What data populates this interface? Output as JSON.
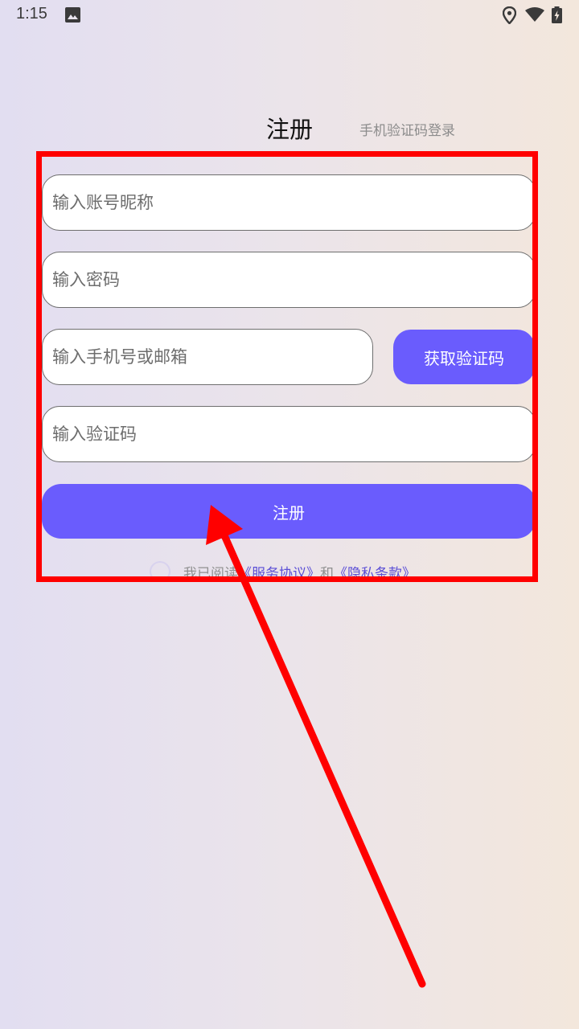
{
  "status_bar": {
    "time": "1:15"
  },
  "tabs": {
    "register": "注册",
    "sms_login": "手机验证码登录"
  },
  "form": {
    "nickname_placeholder": "输入账号昵称",
    "password_placeholder": "输入密码",
    "phone_placeholder": "输入手机号或邮箱",
    "get_code_label": "获取验证码",
    "code_placeholder": "输入验证码",
    "submit_label": "注册"
  },
  "agreement": {
    "prefix": "我已阅读",
    "service_link": "《服务协议》",
    "connector": "和",
    "privacy_link": "《隐私条款》"
  },
  "colors": {
    "accent": "#6a5cfd",
    "annotation": "#ff0000"
  },
  "icons": {
    "status_left": [
      "image-icon"
    ],
    "status_right": [
      "location-icon",
      "wifi-icon",
      "battery-charging-icon"
    ]
  }
}
